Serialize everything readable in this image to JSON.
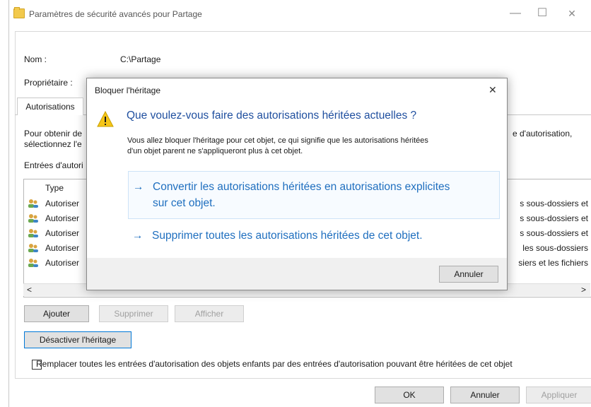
{
  "window": {
    "title": "Paramètres de sécurité avancés pour Partage",
    "minimize": "—",
    "maximize": "☐",
    "close": "✕"
  },
  "header": {
    "name_label": "Nom :",
    "name_value": "C:\\Partage",
    "owner_label": "Propriétaire :"
  },
  "tabs": [
    {
      "label": "Autorisations"
    }
  ],
  "info_text": {
    "line1_left": "Pour obtenir de",
    "line2_left": "sélectionnez l'e",
    "line1_right": "e d'autorisation,",
    "entries_label": "Entrées d'autori"
  },
  "list": {
    "col_type": "Type",
    "rows": [
      {
        "type": "Autoriser",
        "applies": "s sous-dossiers et"
      },
      {
        "type": "Autoriser",
        "applies": "s sous-dossiers et"
      },
      {
        "type": "Autoriser",
        "applies": "s sous-dossiers et"
      },
      {
        "type": "Autoriser",
        "applies": "les sous-dossiers"
      },
      {
        "type": "Autoriser",
        "applies": "siers et les fichiers"
      }
    ],
    "scroll_left": "<",
    "scroll_right": ">"
  },
  "buttons": {
    "add": "Ajouter",
    "remove": "Supprimer",
    "view": "Afficher",
    "disable_inheritance": "Désactiver l'héritage",
    "ok": "OK",
    "cancel": "Annuler",
    "apply": "Appliquer"
  },
  "checkbox": {
    "label": "Remplacer toutes les entrées d'autorisation des objets enfants par des entrées d'autorisation pouvant être héritées de cet objet"
  },
  "dialog": {
    "title": "Bloquer l'héritage",
    "close": "✕",
    "heading": "Que voulez-vous faire des autorisations héritées actuelles ?",
    "body_line1": "Vous allez bloquer l'héritage pour cet objet, ce qui signifie que les autorisations héritées",
    "body_line2": "d'un objet parent ne s'appliqueront plus à cet objet.",
    "option1_line1": "Convertir les autorisations héritées en autorisations explicites",
    "option1_line2": "sur cet objet.",
    "option2": "Supprimer toutes les autorisations héritées de cet objet.",
    "arrow": "→",
    "cancel": "Annuler"
  },
  "colors": {
    "link_blue": "#1f6fbf",
    "warning_yellow": "#f5c518"
  }
}
